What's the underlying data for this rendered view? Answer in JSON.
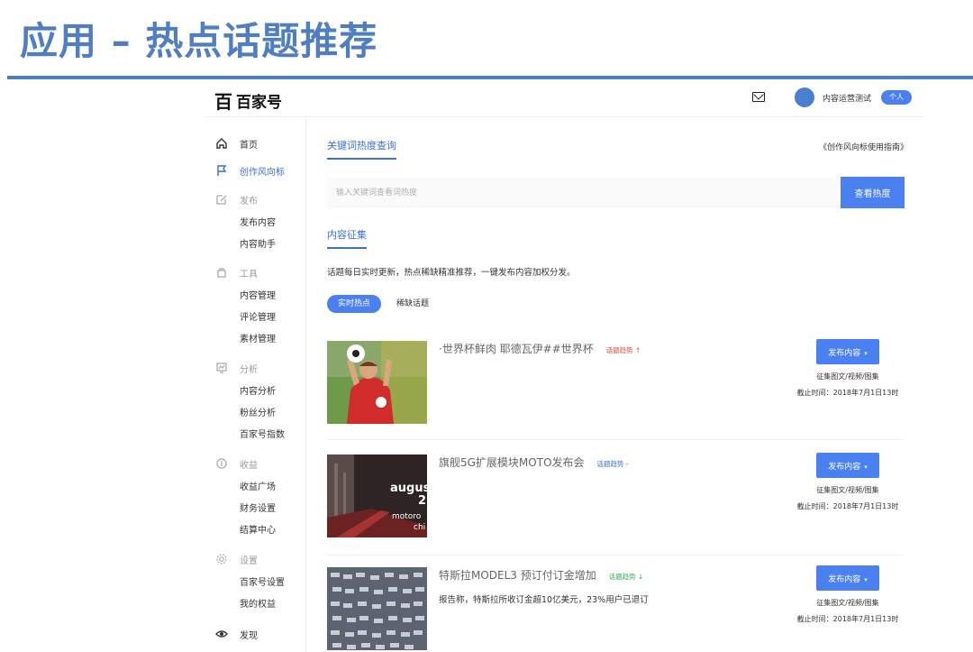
{
  "slide": {
    "title": "应用 – 热点话题推荐"
  },
  "header": {
    "logo_mark": "百",
    "logo_text": "百家号",
    "username": "内容运营测试",
    "user_badge": "个人"
  },
  "sidebar": {
    "home": "首页",
    "trend": "创作风向标",
    "publish": {
      "label": "发布",
      "items": [
        "发布内容",
        "内容助手"
      ]
    },
    "tools": {
      "label": "工具",
      "items": [
        "内容管理",
        "评论管理",
        "素材管理"
      ]
    },
    "analytics": {
      "label": "分析",
      "items": [
        "内容分析",
        "粉丝分析",
        "百家号指数"
      ]
    },
    "income": {
      "label": "收益",
      "items": [
        "收益广场",
        "财务设置",
        "结算中心"
      ]
    },
    "settings": {
      "label": "设置",
      "items": [
        "百家号设置",
        "我的权益"
      ]
    },
    "discover": "发现"
  },
  "main": {
    "keyword_tab": "关键词热度查询",
    "guide_link": "《创作风向标使用指南》",
    "search_placeholder": "输入关键词查看词热度",
    "search_button": "查看热度",
    "collection_tab": "内容征集",
    "description": "话题每日实时更新，热点稀缺精准推荐，一键发布内容加权分发。",
    "filter_active": "实时热点",
    "filter_other": "稀缺话题"
  },
  "topics": [
    {
      "title": "·世界杯鲜肉 耶德瓦伊##世界杯",
      "trend_label": "话题趋势 ↑",
      "subtitle": "",
      "publish_label": "发布内容",
      "types": "征集图文/视频/图集",
      "deadline": "截止时间：2018年7月1日13时"
    },
    {
      "title": "旗舰5G扩展模块MOTO发布会",
      "trend_label": "话题趋势 -",
      "subtitle": "",
      "publish_label": "发布内容",
      "types": "征集图文/视频/图集",
      "deadline": "截止时间：2018年7月1日13时",
      "thumb_text_1": "augus",
      "thumb_text_2": "2",
      "thumb_text_3": "motoro",
      "thumb_text_4": "chi"
    },
    {
      "title": "特斯拉MODEL3 预订付订金增加",
      "trend_label": "话题趋势 ↓",
      "subtitle": "报告称，特斯拉所收订金超10亿美元，23%用户已退订",
      "publish_label": "发布内容",
      "types": "征集图文/视频/图集",
      "deadline": "截止时间：2018年7月1日13时"
    }
  ],
  "colors": {
    "accent": "#4a80f0",
    "slide_blue": "#4f7fc0",
    "trend_up": "#e04a3a",
    "trend_flat": "#3a6fd8",
    "trend_down": "#34a85a"
  }
}
